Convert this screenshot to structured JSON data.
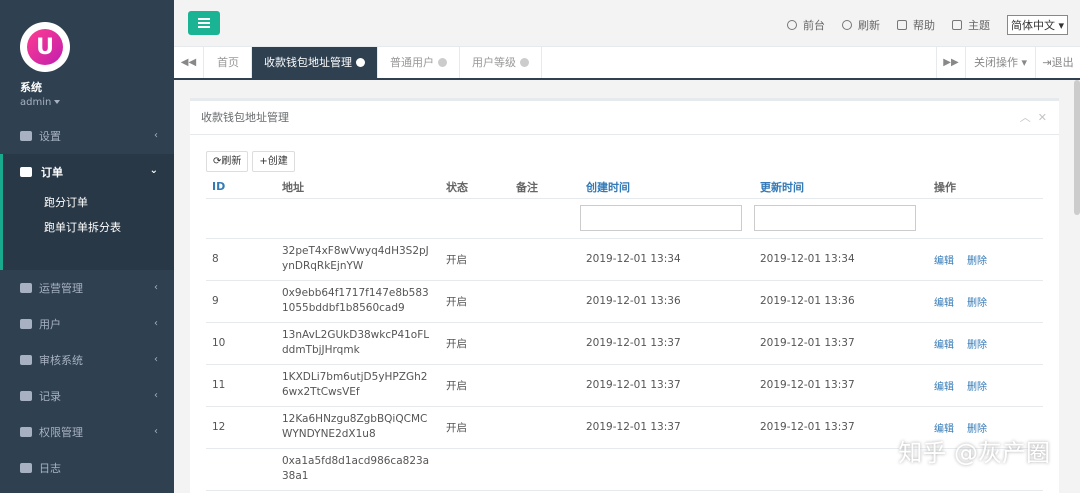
{
  "sidebar": {
    "user_name": "系统",
    "user_role": "admin",
    "items": [
      {
        "label": "设置"
      },
      {
        "label": "订单",
        "open": true,
        "children": [
          "跑分订单",
          "跑单订单拆分表"
        ]
      },
      {
        "label": "运营管理"
      },
      {
        "label": "用户"
      },
      {
        "label": "审核系统"
      },
      {
        "label": "记录"
      },
      {
        "label": "权限管理"
      },
      {
        "label": "日志"
      }
    ]
  },
  "topbar": {
    "links": [
      "前台",
      "刷新",
      "帮助",
      "主题"
    ],
    "language": "简体中文"
  },
  "tabs": [
    {
      "label": "首页",
      "closable": false
    },
    {
      "label": "收款钱包地址管理",
      "closable": true,
      "active": true
    },
    {
      "label": "普通用户",
      "closable": true
    },
    {
      "label": "用户等级",
      "closable": true
    }
  ],
  "tab_ops": {
    "close_label": "关闭操作",
    "logout_label": "退出"
  },
  "panel": {
    "title": "收款钱包地址管理",
    "refresh_label": "刷新",
    "create_label": "创建",
    "columns": [
      "ID",
      "地址",
      "状态",
      "备注",
      "创建时间",
      "更新时间",
      "操作"
    ],
    "rows": [
      {
        "id": "8",
        "address": "32peT4xF8wVwyq4dH3S2pJynDRqRkEjnYW",
        "status": "开启",
        "remark": "",
        "created": "2019-12-01 13:34",
        "updated": "2019-12-01 13:34"
      },
      {
        "id": "9",
        "address": "0x9ebb64f1717f147e8b5831055bddbf1b8560cad9",
        "status": "开启",
        "remark": "",
        "created": "2019-12-01 13:36",
        "updated": "2019-12-01 13:36"
      },
      {
        "id": "10",
        "address": "13nAvL2GUkD38wkcP41oFLddmTbjJHrqmk",
        "status": "开启",
        "remark": "",
        "created": "2019-12-01 13:37",
        "updated": "2019-12-01 13:37"
      },
      {
        "id": "11",
        "address": "1KXDLi7bm6utjD5yHPZGh26wx2TtCwsVEf",
        "status": "开启",
        "remark": "",
        "created": "2019-12-01 13:37",
        "updated": "2019-12-01 13:37"
      },
      {
        "id": "12",
        "address": "12Ka6HNzgu8ZgbBQiQCMCWYNDYNE2dX1u8",
        "status": "开启",
        "remark": "",
        "created": "2019-12-01 13:37",
        "updated": "2019-12-01 13:37"
      },
      {
        "id": "",
        "address": "0xa1a5fd8d1acd986ca823a38a1",
        "status": "",
        "remark": "",
        "created": "",
        "updated": ""
      }
    ],
    "edit_label": "编辑",
    "delete_label": "删除"
  },
  "watermark": "知乎 @灰产圈",
  "colors": {
    "sidebar": "#2f4050",
    "accent": "#1ab394",
    "link": "#337ab7"
  }
}
